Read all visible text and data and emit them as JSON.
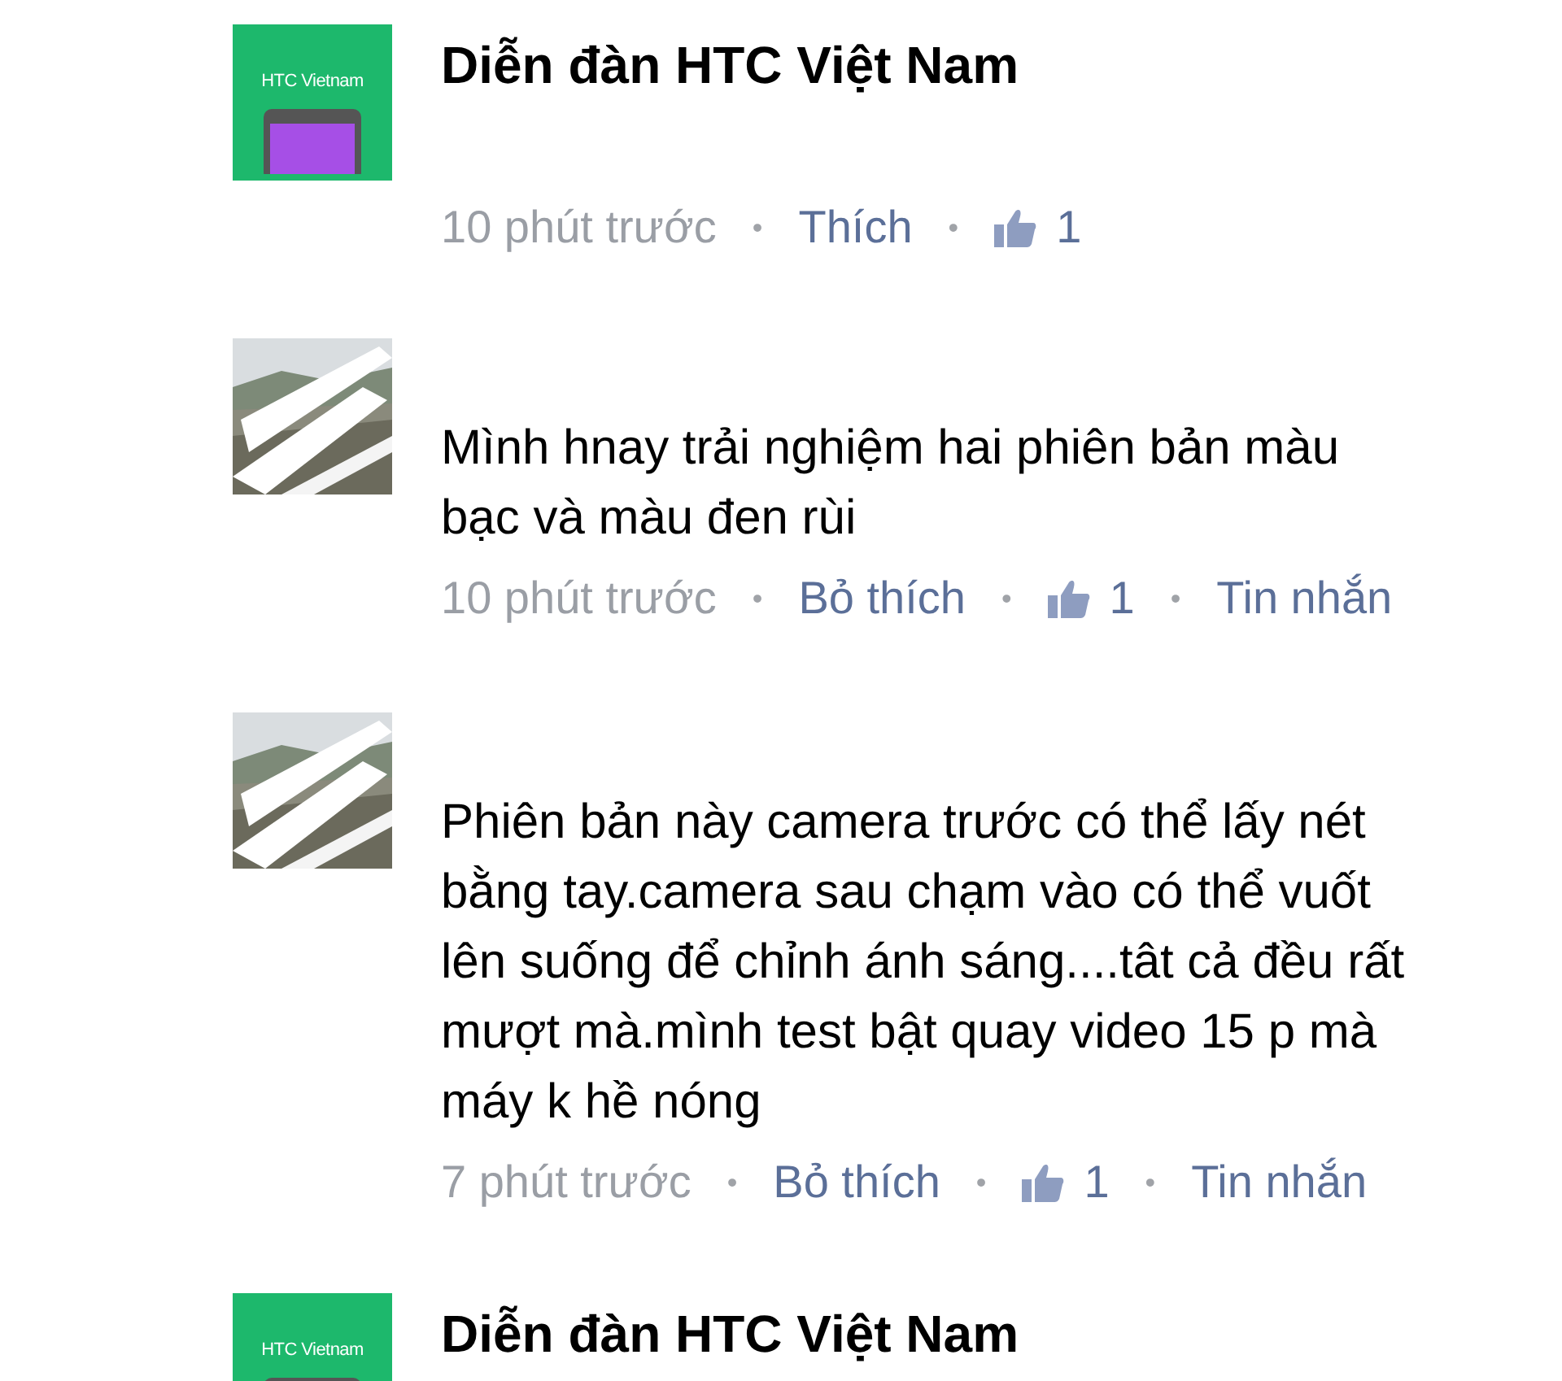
{
  "comments": [
    {
      "avatar": {
        "kind": "logo",
        "text": "HTC Vietnam"
      },
      "author": "Diễn đàn HTC Việt Nam",
      "time": "10 phút trước",
      "separator": "•",
      "like_link": "Thích",
      "likes": "1"
    },
    {
      "body_lines": [
        "Mình hnay trải nghiệm hai phiên bản màu",
        "bạc và màu đen rùi"
      ],
      "time": "10 phút trước",
      "separator": "•",
      "like_link": "Bỏ thích",
      "likes": "1",
      "reply_link": "Tin nhắn"
    },
    {
      "body_lines": [
        "Phiên bản này camera trước có thể lấy nét",
        "bằng tay.camera sau chạm vào có thể vuốt",
        "lên suống để chỉnh ánh sáng....tât cả đều rất",
        "mượt mà.mình test bật quay video 15 p mà",
        "máy k hề nóng"
      ],
      "time": "7 phút trước",
      "separator": "•",
      "like_link": "Bỏ thích",
      "likes": "1",
      "reply_link": "Tin nhắn"
    },
    {
      "avatar": {
        "kind": "logo",
        "text": "HTC Vietnam"
      },
      "author": "Diễn đàn HTC Việt Nam"
    }
  ]
}
